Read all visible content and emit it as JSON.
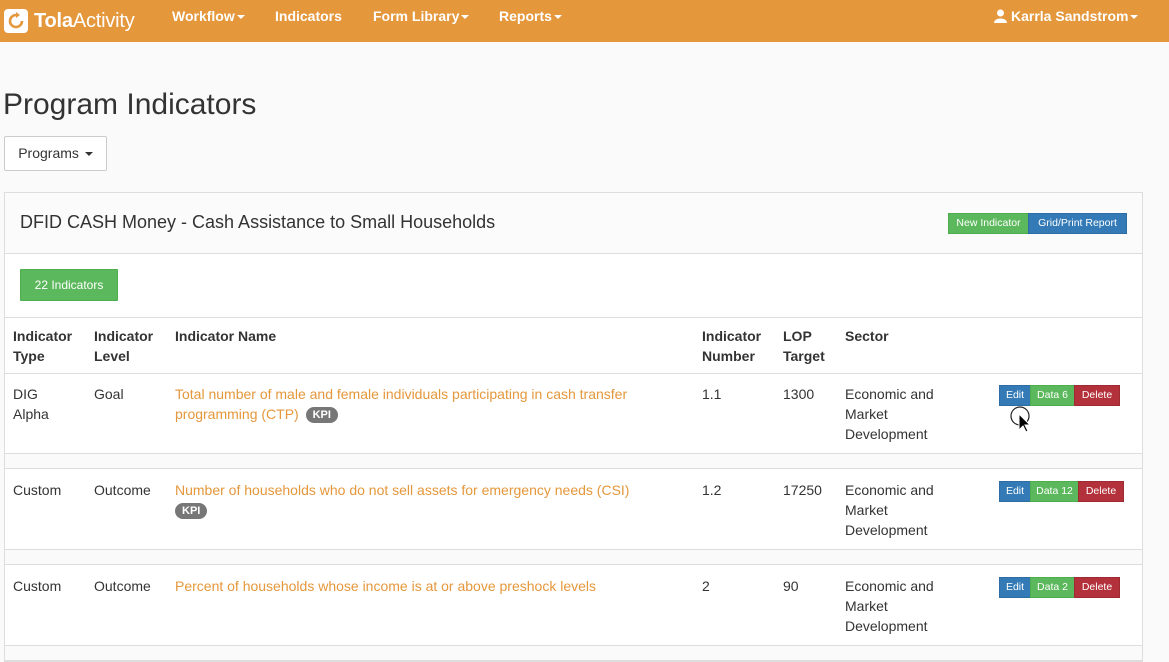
{
  "nav": {
    "brand_bold": "Tola",
    "brand_light": "Activity",
    "items": [
      "Workflow",
      "Indicators",
      "Form Library",
      "Reports"
    ],
    "user": "Karrla Sandstrom"
  },
  "page_title": "Program Indicators",
  "programs_button": "Programs",
  "panel": {
    "title": "DFID CASH Money - Cash Assistance to Small Households",
    "new_indicator": "New Indicator",
    "grid_report": "Grid/Print Report",
    "count_label": "22 Indicators"
  },
  "table": {
    "headers": {
      "type": [
        "Indicator",
        "Type"
      ],
      "level": [
        "Indicator",
        "Level"
      ],
      "name": "Indicator Name",
      "number": [
        "Indicator",
        "Number"
      ],
      "lop": [
        "LOP",
        "Target"
      ],
      "sector": "Sector"
    },
    "rows": [
      {
        "type": [
          "DIG",
          "Alpha"
        ],
        "level": "Goal",
        "name": [
          "Total number of male and female individuals participating in cash transfer",
          "programming (CTP)"
        ],
        "kpi": "KPI",
        "number": "1.1",
        "lop": "1300",
        "sector": [
          "Economic and",
          "Market",
          "Development"
        ],
        "edit": "Edit",
        "data": "Data 6",
        "delete": "Delete"
      },
      {
        "type": [
          "Custom"
        ],
        "level": "Outcome",
        "name": [
          "Number of households who do not sell assets for emergency needs (CSI)"
        ],
        "kpi": "KPI",
        "number": "1.2",
        "lop": "17250",
        "sector": [
          "Economic and",
          "Market",
          "Development"
        ],
        "edit": "Edit",
        "data": "Data 12",
        "delete": "Delete"
      },
      {
        "type": [
          "Custom"
        ],
        "level": "Outcome",
        "name": [
          "Percent of households whose income is at or above preshock levels"
        ],
        "kpi": "",
        "number": "2",
        "lop": "90",
        "sector": [
          "Economic and",
          "Market",
          "Development"
        ],
        "edit": "Edit",
        "data": "Data 2",
        "delete": "Delete"
      }
    ]
  },
  "colors": {
    "navbar": "#e5973b",
    "link": "#e5973b",
    "success": "#5cb85c",
    "primary": "#337ab7",
    "danger": "#b3313a",
    "kpi_badge": "#777777"
  }
}
